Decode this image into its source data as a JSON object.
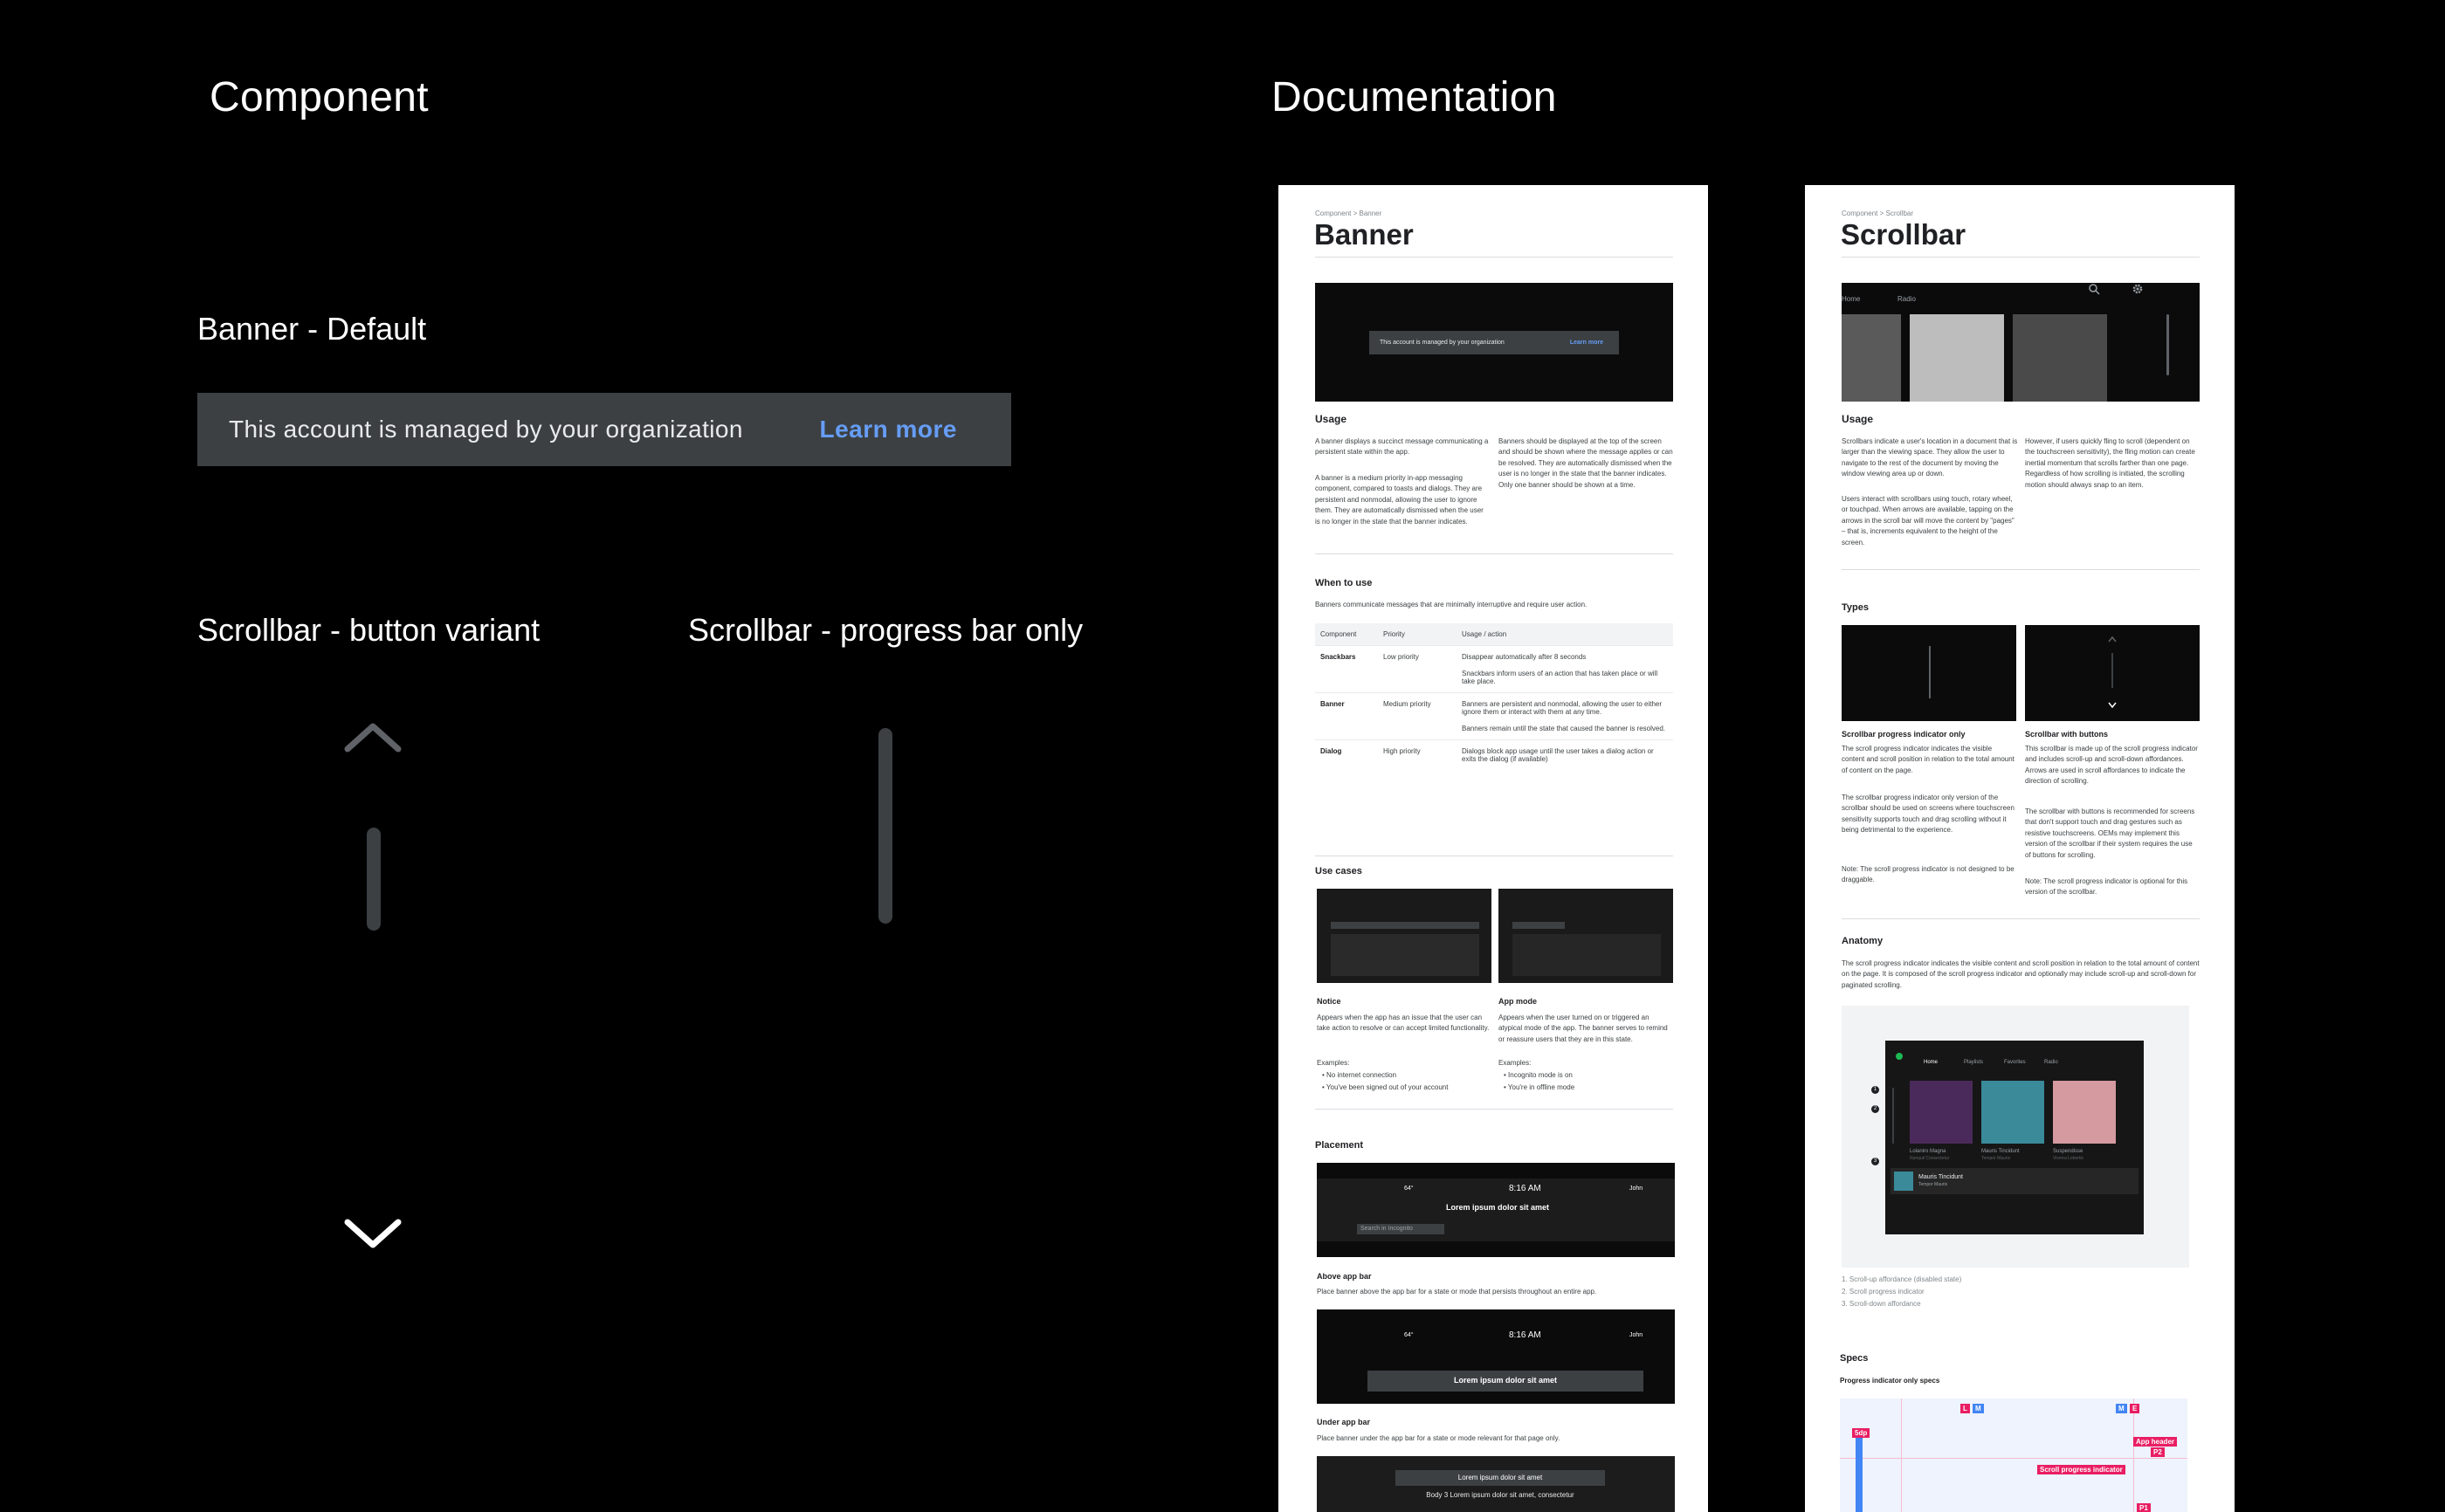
{
  "sections": {
    "component": "Component",
    "documentation": "Documentation"
  },
  "banner_default": {
    "label": "Banner - Default",
    "message": "This account is managed by your organization",
    "action": "Learn more"
  },
  "scrollbar_button": {
    "label": "Scrollbar -  button variant"
  },
  "scrollbar_progress": {
    "label": "Scrollbar -  progress bar only"
  },
  "doc_banner": {
    "breadcrumb": "Component > Banner",
    "title": "Banner",
    "preview_message": "This account is managed by your organization",
    "preview_action": "Learn more",
    "usage_title": "Usage",
    "usage_p1": "A banner displays a succinct message communicating a persistent state within the app.",
    "usage_p2": "A banner is a medium priority in-app messaging component, compared to toasts and dialogs. They are persistent and nonmodal, allowing the user to ignore them. They are automatically dismissed when the user is no longer in the state that the banner indicates.",
    "usage_p3": "Banners should be displayed at the top of the screen and should be shown where the message applies or can be resolved. They are automatically dismissed when the user is no longer in the state that the banner indicates. Only one banner should be shown at a time.",
    "when_title": "When to use",
    "when_text": "Banners communicate messages that are minimally interruptive and require user action.",
    "table": {
      "headers": [
        "Component",
        "Priority",
        "Usage / action"
      ],
      "rows": [
        {
          "component": "Snackbars",
          "priority": "Low priority",
          "usage": "Disappear automatically after 8 seconds",
          "usage2": "Snackbars inform users of an action that has taken place or will take place."
        },
        {
          "component": "Banner",
          "priority": "Medium priority",
          "usage": "Banners are persistent and nonmodal, allowing the user to either ignore them or interact with them at any time.",
          "usage2": "Banners remain until the state that caused the banner is resolved."
        },
        {
          "component": "Dialog",
          "priority": "High priority",
          "usage": "Dialogs block app usage until the user takes a dialog action or exits the dialog (if available)",
          "usage2": ""
        }
      ]
    },
    "usecases_title": "Use cases",
    "notice_title": "Notice",
    "notice_text": "Appears when the app has an issue that the user can take action to resolve or can accept limited functionality.",
    "notice_examples": "Examples:",
    "notice_ex1": "No internet connection",
    "notice_ex2": "You've been signed out of your account",
    "appmode_title": "App mode",
    "appmode_text": "Appears when the user turned on or triggered an atypical mode of the app. The banner serves to remind or reassure users that they are in this state.",
    "appmode_examples": "Examples:",
    "appmode_ex1": "Incognito mode is on",
    "appmode_ex2": "You're in offline mode",
    "placement_title": "Placement",
    "time": "8:16 AM",
    "temp": "64°",
    "user": "John",
    "lorem": "Lorem ipsum dolor sit amet",
    "search_placeholder": "Search in Incognito",
    "above_title": "Above app bar",
    "above_text": "Place banner above the app bar for a state or mode that persists throughout an entire app.",
    "under_title": "Under app bar",
    "under_text": "Place banner under the app bar for a state or mode relevant for that page only.",
    "body3": "Body 3 Lorem ipsum dolor sit amet, consectetur"
  },
  "doc_scrollbar": {
    "breadcrumb": "Component > Scrollbar",
    "title": "Scrollbar",
    "preview_tab1": "Home",
    "preview_tab2": "Radio",
    "usage_title": "Usage",
    "usage_p1": "Scrollbars indicate a user's location in a document that is larger than the viewing space. They allow the user to navigate to the rest of the document by moving the window viewing area up or down.",
    "usage_p2": "Users interact with scrollbars using touch, rotary wheel, or touchpad. When arrows are available, tapping on the arrows in the scroll bar will move the content by \"pages\" – that is, increments equivalent to the height of the screen.",
    "usage_p3": "However, if users quickly fling to scroll (dependent on the touchscreen sensitivity), the fling motion can create inertial momentum that scrolls farther than one page. Regardless of how scrolling is initiated, the scrolling motion should always snap to an item.",
    "types_title": "Types",
    "type1_title": "Scrollbar progress indicator only",
    "type1_p1": "The scroll progress indicator indicates the visible content and scroll position in relation to the total amount of content on the page.",
    "type1_p2": "The scrollbar progress indicator only version of the scrollbar should be used on screens where touchscreen sensitivity supports touch and drag scrolling without it being detrimental to the experience.",
    "type1_note": "Note: The scroll progress indicator is not designed to be draggable.",
    "type2_title": "Scrollbar with buttons",
    "type2_p1": "This scrollbar is made up of the scroll progress indicator and includes scroll-up and scroll-down affordances. Arrows are used in scroll affordances to indicate the direction of scrolling.",
    "type2_p2": "The scrollbar with buttons is recommended for screens that don't support touch and drag gestures such as resistive touchscreens. OEMs may implement this version of the scrollbar if their system requires the use of buttons for scrolling.",
    "type2_note": "Note: The scroll progress indicator is optional for this version of the scrollbar.",
    "anatomy_title": "Anatomy",
    "anatomy_text": "The scroll progress indicator indicates the visible content and scroll position in relation to the total amount of content on the page. It is composed of the scroll progress indicator and optionally may include scroll-up and scroll-down for paginated scrolling.",
    "anatomy_tabs": [
      "Home",
      "Playlists",
      "Favorites",
      "Radio"
    ],
    "anatomy_cards": [
      {
        "title": "Lolaniro Magna",
        "sub": "Nunquil Consectetur"
      },
      {
        "title": "Mauris Tincidunt",
        "sub": "Tempor Mauris"
      },
      {
        "title": "Suspendisse",
        "sub": "Viverra Lobortis"
      }
    ],
    "now_playing_title": "Mauris Tincidunt",
    "now_playing_sub": "Tempor Mauris",
    "markers": [
      "1",
      "2",
      "3"
    ],
    "legend": [
      "1. Scroll-up affordance (disabled state)",
      "2. Scroll progress indicator",
      "3. Scroll-down affordance"
    ],
    "specs_title": "Specs",
    "specs_subtitle": "Progress indicator only specs",
    "spec_tags": {
      "dp": "5dp",
      "app_header": "App header",
      "p2": "P2",
      "scroll_indicator": "Scroll progress indicator",
      "p1": "P1",
      "l": "L",
      "m": "M",
      "m2": "M",
      "e": "E"
    }
  }
}
